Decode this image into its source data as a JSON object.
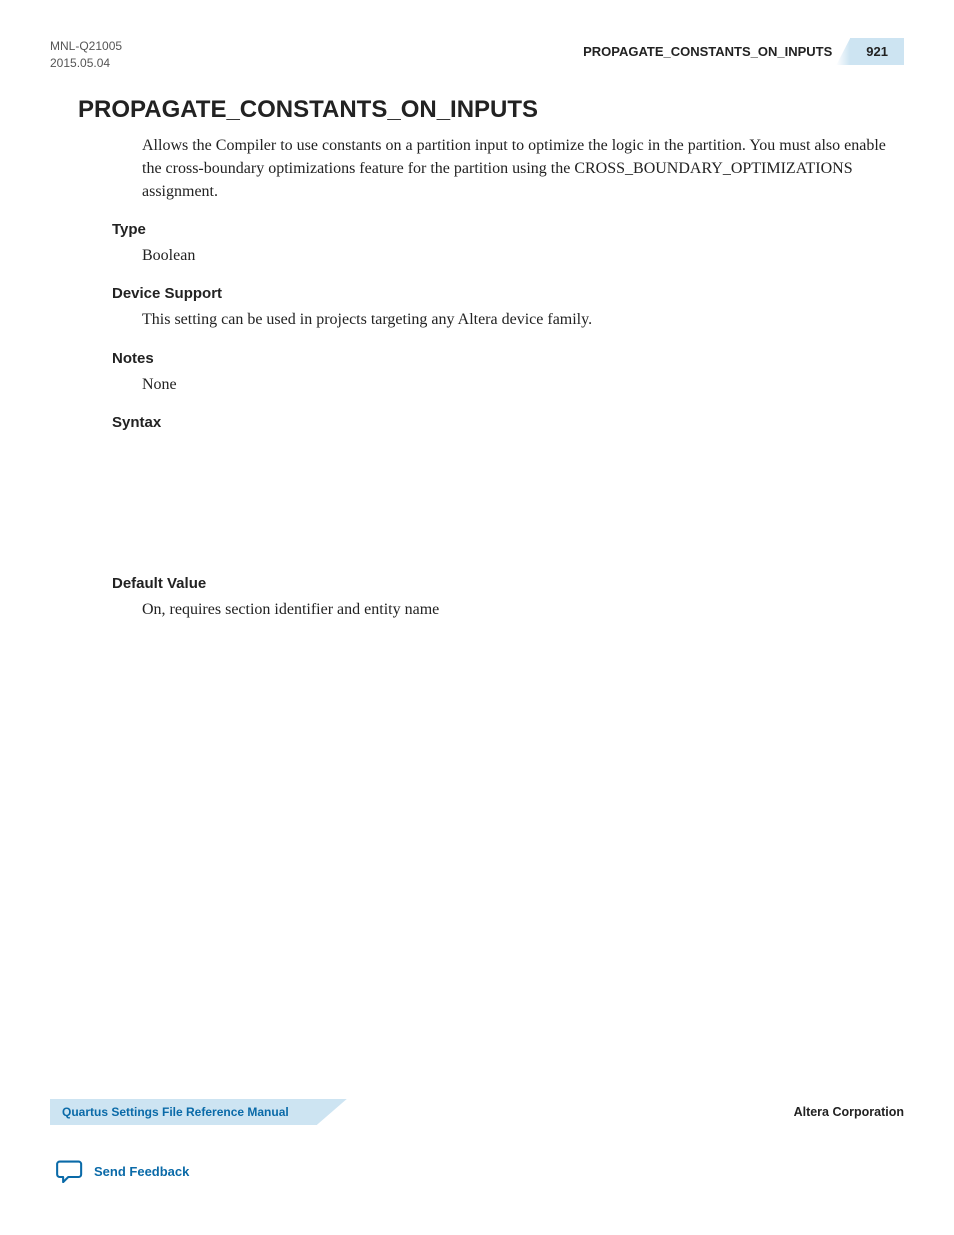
{
  "header": {
    "doc_id": "MNL-Q21005",
    "date": "2015.05.04",
    "topic": "PROPAGATE_CONSTANTS_ON_INPUTS",
    "page_number": "921"
  },
  "title": "PROPAGATE_CONSTANTS_ON_INPUTS",
  "description": "Allows the Compiler to use constants on a partition input to optimize the logic in the partition. You must also enable the cross-boundary optimizations feature for the partition using the CROSS_BOUNDARY_OPTIMIZATIONS assignment.",
  "sections": {
    "type": {
      "label": "Type",
      "value": "Boolean"
    },
    "device_support": {
      "label": "Device Support",
      "value": "This setting can be used in projects targeting any Altera device family."
    },
    "notes": {
      "label": "Notes",
      "value": "None"
    },
    "syntax": {
      "label": "Syntax"
    },
    "default_value": {
      "label": "Default Value",
      "value": "On, requires section identifier and entity name"
    }
  },
  "footer": {
    "manual": "Quartus Settings File Reference Manual",
    "company": "Altera Corporation",
    "feedback": "Send Feedback"
  }
}
